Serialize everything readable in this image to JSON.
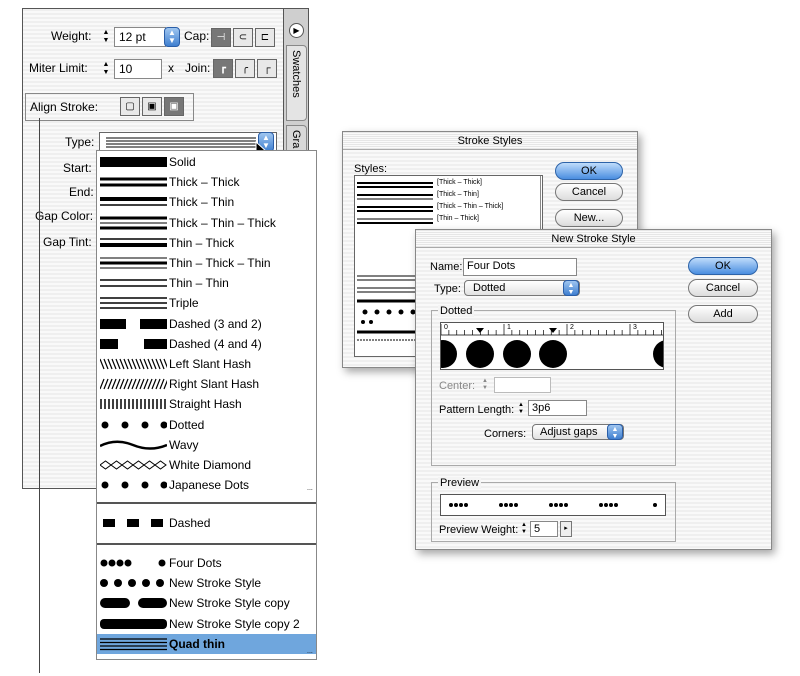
{
  "palette": {
    "weight_label": "Weight:",
    "weight_value": "12 pt",
    "cap_label": "Cap:",
    "miter_label": "Miter Limit:",
    "miter_value": "10",
    "miter_unit": "x",
    "join_label": "Join:",
    "align_label": "Align Stroke:",
    "type_label": "Type:",
    "start_label": "Start:",
    "end_label": "End:",
    "gap_color_label": "Gap Color:",
    "gap_tint_label": "Gap Tint:",
    "tabs": [
      "Swatches",
      "Gra"
    ]
  },
  "type_list": {
    "items": [
      {
        "label": "Solid",
        "icon": "solid"
      },
      {
        "label": "Thick – Thick",
        "icon": "thick-thick"
      },
      {
        "label": "Thick – Thin",
        "icon": "thick-thin"
      },
      {
        "label": "Thick – Thin – Thick",
        "icon": "thick-thin-thick"
      },
      {
        "label": "Thin – Thick",
        "icon": "thin-thick"
      },
      {
        "label": "Thin – Thick – Thin",
        "icon": "thin-thick-thin"
      },
      {
        "label": "Thin – Thin",
        "icon": "thin-thin"
      },
      {
        "label": "Triple",
        "icon": "triple"
      },
      {
        "label": "Dashed (3 and 2)",
        "icon": "dashed-3-2"
      },
      {
        "label": "Dashed (4 and 4)",
        "icon": "dashed-4-4"
      },
      {
        "label": "Left Slant Hash",
        "icon": "left-slant"
      },
      {
        "label": "Right Slant Hash",
        "icon": "right-slant"
      },
      {
        "label": "Straight Hash",
        "icon": "straight-hash"
      },
      {
        "label": "Dotted",
        "icon": "dotted"
      },
      {
        "label": "Wavy",
        "icon": "wavy"
      },
      {
        "label": "White Diamond",
        "icon": "white-diamond"
      },
      {
        "label": "Japanese Dots",
        "icon": "japanese-dots"
      }
    ],
    "dashed_item": "Dashed",
    "custom_items": [
      {
        "label": "Four Dots",
        "icon": "four-dots"
      },
      {
        "label": "New Stroke Style",
        "icon": "new-stroke-style"
      },
      {
        "label": "New Stroke Style copy",
        "icon": "new-stroke-style-copy"
      },
      {
        "label": "New Stroke Style copy 2",
        "icon": "new-stroke-style-copy-2"
      },
      {
        "label": "Quad thin",
        "icon": "quad-thin"
      }
    ],
    "selected": "Quad thin",
    "highlight_color": "#6fa6dd"
  },
  "stroke_styles": {
    "title": "Stroke Styles",
    "styles_label": "Styles:",
    "items": [
      "[Thick – Thick]",
      "[Thick – Thin]",
      "[Thick – Thin – Thick]",
      "[Thin – Thick]"
    ],
    "ok": "OK",
    "cancel": "Cancel",
    "new": "New..."
  },
  "new_stroke_style": {
    "title": "New Stroke Style",
    "name_label": "Name:",
    "name_value": "Four Dots",
    "type_label": "Type:",
    "type_value": "Dotted",
    "group_label": "Dotted",
    "ruler_numbers": [
      "0",
      "1",
      "2",
      "3"
    ],
    "center_label": "Center:",
    "pattern_length_label": "Pattern Length:",
    "pattern_length_value": "3p6",
    "corners_label": "Corners:",
    "corners_value": "Adjust gaps",
    "preview_label": "Preview",
    "preview_weight_label": "Preview Weight:",
    "preview_weight_value": "5",
    "ok": "OK",
    "cancel": "Cancel",
    "add": "Add"
  },
  "colors": {
    "accent": "#3f7fd0",
    "highlight": "#6fa6dd"
  }
}
